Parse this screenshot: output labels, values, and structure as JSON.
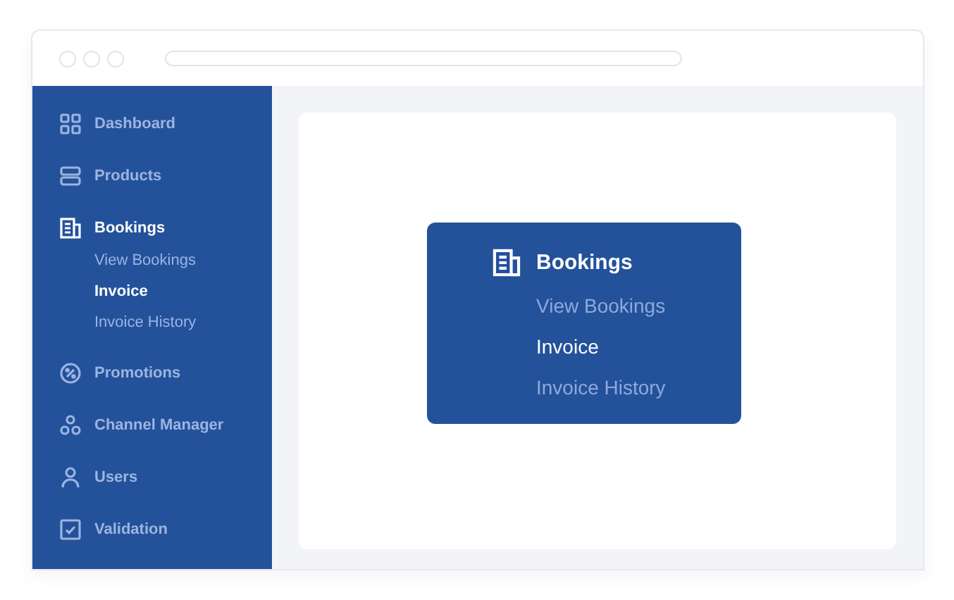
{
  "sidebar": {
    "items": [
      {
        "kind": "grid",
        "label": "Dashboard",
        "selected": false
      },
      {
        "kind": "stack",
        "label": "Products",
        "selected": false
      },
      {
        "kind": "document",
        "label": "Bookings",
        "selected": true,
        "children": [
          {
            "label": "View Bookings",
            "selected": false
          },
          {
            "label": "Invoice",
            "selected": true
          },
          {
            "label": "Invoice History",
            "selected": false
          }
        ]
      },
      {
        "kind": "percent",
        "label": "Promotions",
        "selected": false
      },
      {
        "kind": "circles",
        "label": "Channel Manager",
        "selected": false
      },
      {
        "kind": "person",
        "label": "Users",
        "selected": false
      },
      {
        "kind": "check",
        "label": "Validation",
        "selected": false
      }
    ]
  },
  "preview_card": {
    "kind": "document",
    "label": "Bookings",
    "children": [
      {
        "label": "View Bookings",
        "selected": false
      },
      {
        "label": "Invoice",
        "selected": true
      },
      {
        "label": "Invoice History",
        "selected": false
      }
    ]
  }
}
